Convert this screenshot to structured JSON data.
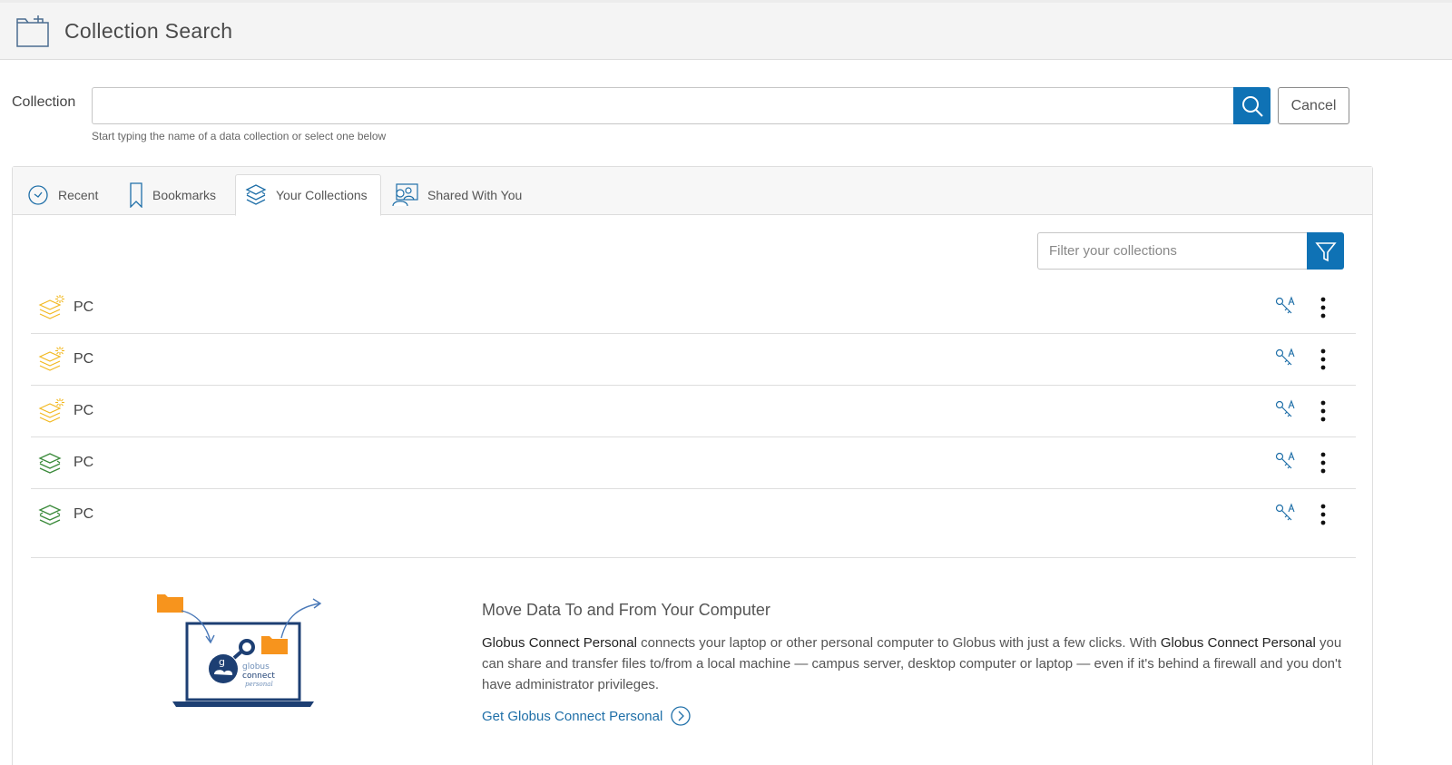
{
  "header": {
    "title": "Collection Search",
    "icon": "folder-icon"
  },
  "search": {
    "label": "Collection",
    "value": "",
    "placeholder": "",
    "hint": "Start typing the name of a data collection or select one below",
    "cancel_label": "Cancel"
  },
  "tabs": [
    {
      "label": "Recent",
      "icon": "clock-icon"
    },
    {
      "label": "Bookmarks",
      "icon": "bookmark-icon"
    },
    {
      "label": "Your Collections",
      "icon": "layers-icon",
      "active": true
    },
    {
      "label": "Shared With You",
      "icon": "shared-people-icon"
    }
  ],
  "filter": {
    "placeholder": "Filter your collections"
  },
  "collections": [
    {
      "name": "PC",
      "status": "yellow",
      "icon": "personal-endpoint-icon"
    },
    {
      "name": "PC",
      "status": "yellow",
      "icon": "personal-endpoint-icon"
    },
    {
      "name": "PC",
      "status": "yellow",
      "icon": "personal-endpoint-icon"
    },
    {
      "name": "PC",
      "status": "green",
      "icon": "endpoint-connected-icon"
    },
    {
      "name": "PC",
      "status": "green",
      "icon": "endpoint-connected-icon"
    }
  ],
  "promo": {
    "title": "Move Data To and From Your Computer",
    "p1_bold": "Globus Connect Personal",
    "p1_text": " connects your laptop or other personal computer to Globus with just a few clicks. With ",
    "p2_bold": "Globus Connect Personal",
    "p2_text": " you can share and transfer files to/from a local machine — campus server, desktop computer or laptop — even if it's behind a firewall and you don't have administrator privileges.",
    "link_label": "Get Globus Connect Personal",
    "logo_lines": [
      "globus",
      "connect",
      "personal"
    ]
  },
  "colors": {
    "accent": "#0f72b5",
    "status_yellow": "#f2b81f",
    "status_green": "#3a8a3a",
    "link": "#1f6fa8",
    "folder_orange": "#f7941d"
  }
}
